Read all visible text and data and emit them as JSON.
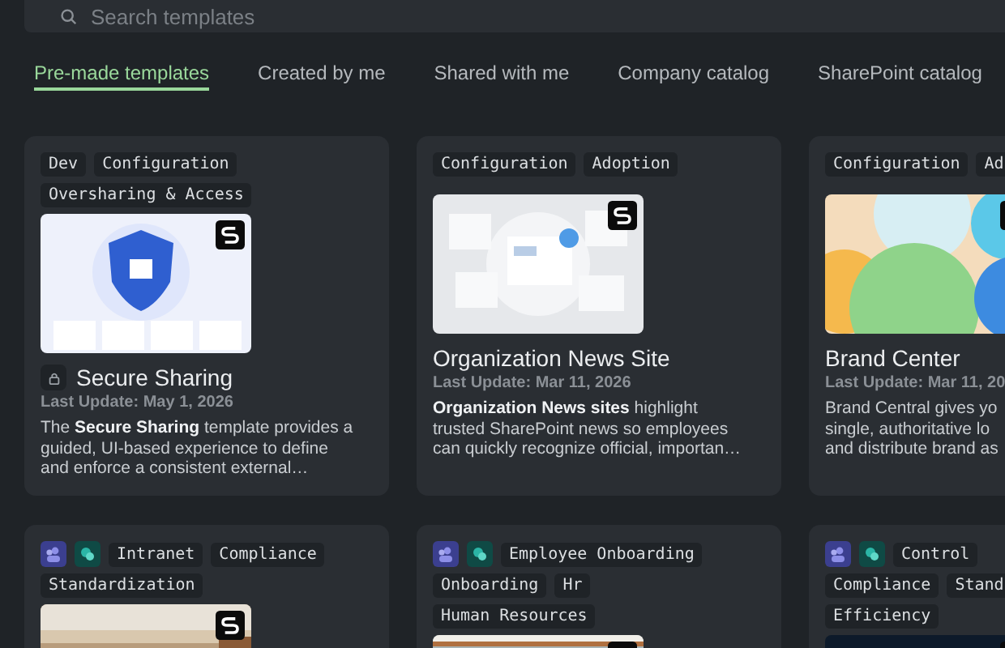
{
  "search": {
    "placeholder": "Search templates"
  },
  "tabs": [
    {
      "label": "Pre-made templates",
      "selected": true
    },
    {
      "label": "Created by me",
      "selected": false
    },
    {
      "label": "Shared with me",
      "selected": false
    },
    {
      "label": "Company catalog",
      "selected": false
    },
    {
      "label": "SharePoint catalog",
      "selected": false
    }
  ],
  "cards": [
    {
      "tag_rows": [
        [
          "Dev",
          "Configuration"
        ],
        [
          "Oversharing & Access"
        ]
      ],
      "kind": "locked",
      "title": "Secure Sharing",
      "date": "Last Update: May 1, 2026",
      "description_lines": [
        "The **Secure Sharing** template provides a",
        "guided, UI-based experience to define",
        "and enforce a consistent external…"
      ]
    },
    {
      "kind": "open",
      "tag_rows": [
        [
          "Configuration",
          "Adoption"
        ]
      ],
      "title": "Organization News Site",
      "date": "Last Update: Mar 11, 2026",
      "description_lines": [
        "**Organization News sites** highlight",
        "trusted SharePoint news so employees",
        "can quickly recognize official, importan…"
      ]
    },
    {
      "kind": "open",
      "tag_rows": [
        [
          "Configuration",
          "Ad"
        ]
      ],
      "title": "Brand Center",
      "date": "Last Update: Mar 11, 20",
      "description_lines": [
        "Brand Central gives yo",
        "single, authoritative lo",
        "and distribute brand as"
      ]
    },
    {
      "app_icons": [
        {
          "kind": "people"
        },
        {
          "kind": "stream"
        }
      ],
      "tag_rows": [
        [
          "Intranet",
          "Compliance"
        ],
        [
          "Standardization"
        ]
      ]
    },
    {
      "app_icons": [
        {
          "kind": "people"
        },
        {
          "kind": "stream"
        }
      ],
      "tag_rows": [
        [
          "Employee Onboarding"
        ],
        [
          "Onboarding",
          "Hr"
        ],
        [
          "Human Resources"
        ]
      ]
    },
    {
      "app_icons": [
        {
          "kind": "people"
        },
        {
          "kind": "stream"
        }
      ],
      "tag_rows": [
        [
          "Control"
        ],
        [
          "Compliance",
          "Stand"
        ],
        [
          "Efficiency"
        ]
      ]
    }
  ]
}
